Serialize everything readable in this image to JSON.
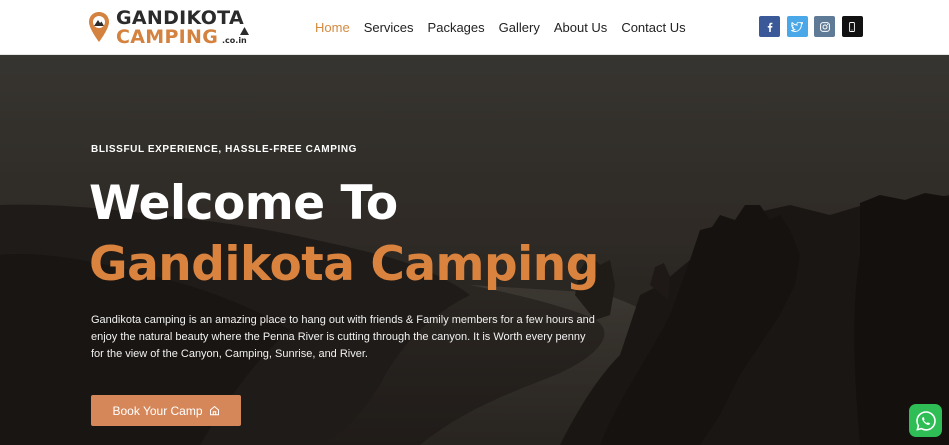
{
  "logo": {
    "line1": "GANDIKOTA",
    "line2": "CAMPING",
    "suffix": ".co.in"
  },
  "nav": {
    "items": [
      {
        "label": "Home",
        "active": true
      },
      {
        "label": "Services",
        "active": false
      },
      {
        "label": "Packages",
        "active": false
      },
      {
        "label": "Gallery",
        "active": false
      },
      {
        "label": "About Us",
        "active": false
      },
      {
        "label": "Contact Us",
        "active": false
      }
    ]
  },
  "social": {
    "icons": [
      "facebook-icon",
      "twitter-icon",
      "instagram-icon",
      "phone-icon"
    ]
  },
  "hero": {
    "tagline": "BLISSFUL EXPERIENCE, HASSLE-FREE CAMPING",
    "title_line1": "Welcome To",
    "title_line2": "Gandikota Camping",
    "description": "Gandikota camping is an amazing place to hang out with friends & Family members for a few hours and enjoy the natural beauty where the Penna River is cutting through the canyon. It is Worth every penny for the view of the Canyon, Camping, Sunrise, and River.",
    "cta_label": "Book Your Camp",
    "cta_icon": "home-icon"
  },
  "floating": {
    "whatsapp_icon": "whatsapp-icon"
  },
  "colors": {
    "accent": "#d9833f",
    "cta_bg": "#d6875a",
    "whatsapp": "#2fbd55",
    "facebook": "#3b5998",
    "twitter": "#4aa8e8",
    "instagram": "#5e7a96"
  }
}
